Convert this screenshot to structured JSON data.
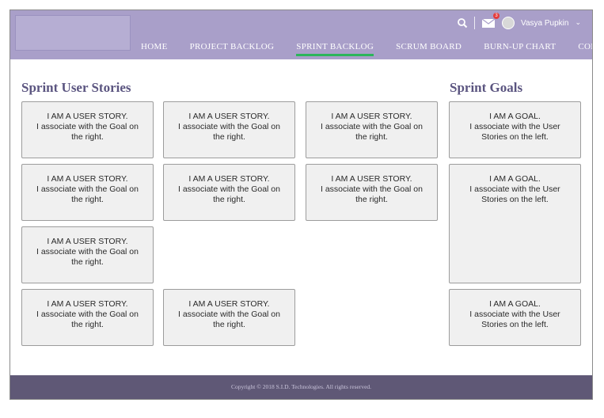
{
  "nav": {
    "items": [
      {
        "label": "HOME"
      },
      {
        "label": "PROJECT BACKLOG"
      },
      {
        "label": "SPRINT BACKLOG"
      },
      {
        "label": "SCRUM BOARD"
      },
      {
        "label": "BURN-UP CHART"
      },
      {
        "label": "CONTACT US"
      }
    ],
    "active_index": 2
  },
  "user": {
    "name": "Vasya Pupkin",
    "notification_count": "3"
  },
  "colors": {
    "topbar": "#a99fc9",
    "active_underline": "#2cb55a",
    "section_title": "#5b5580",
    "footer": "#5f5876"
  },
  "stories": {
    "title": "Sprint User Stories",
    "items": [
      {
        "line1": "I AM A USER STORY.",
        "line2": "I associate with the Goal on the right."
      },
      {
        "line1": "I AM A USER STORY.",
        "line2": "I associate with the Goal on the right."
      },
      {
        "line1": "I AM A USER STORY.",
        "line2": "I associate with the Goal on the right."
      },
      {
        "line1": "I AM A USER STORY.",
        "line2": "I associate with the Goal on the right."
      },
      {
        "line1": "I AM A USER STORY.",
        "line2": "I associate with the Goal on the right."
      },
      {
        "line1": "I AM A USER STORY.",
        "line2": "I associate with the Goal on the right."
      },
      {
        "line1": "I AM A USER STORY.",
        "line2": "I associate with the Goal on the right."
      },
      {
        "line1": "I AM A USER STORY.",
        "line2": "I associate with the Goal on the right."
      },
      {
        "line1": "I AM A USER STORY.",
        "line2": "I associate with the Goal on the right."
      }
    ]
  },
  "goals": {
    "title": "Sprint Goals",
    "items": [
      {
        "line1": "I AM A GOAL.",
        "line2": "I associate with the User Stories on the left."
      },
      {
        "line1": "I AM A GOAL.",
        "line2": "I associate with the User Stories on the left."
      },
      {
        "line1": "I AM A GOAL.",
        "line2": "I associate with the User Stories on the left."
      }
    ]
  },
  "footer": {
    "copyright": "Copyright © 2018 S.I.D. Technologies. All rights reserved."
  }
}
